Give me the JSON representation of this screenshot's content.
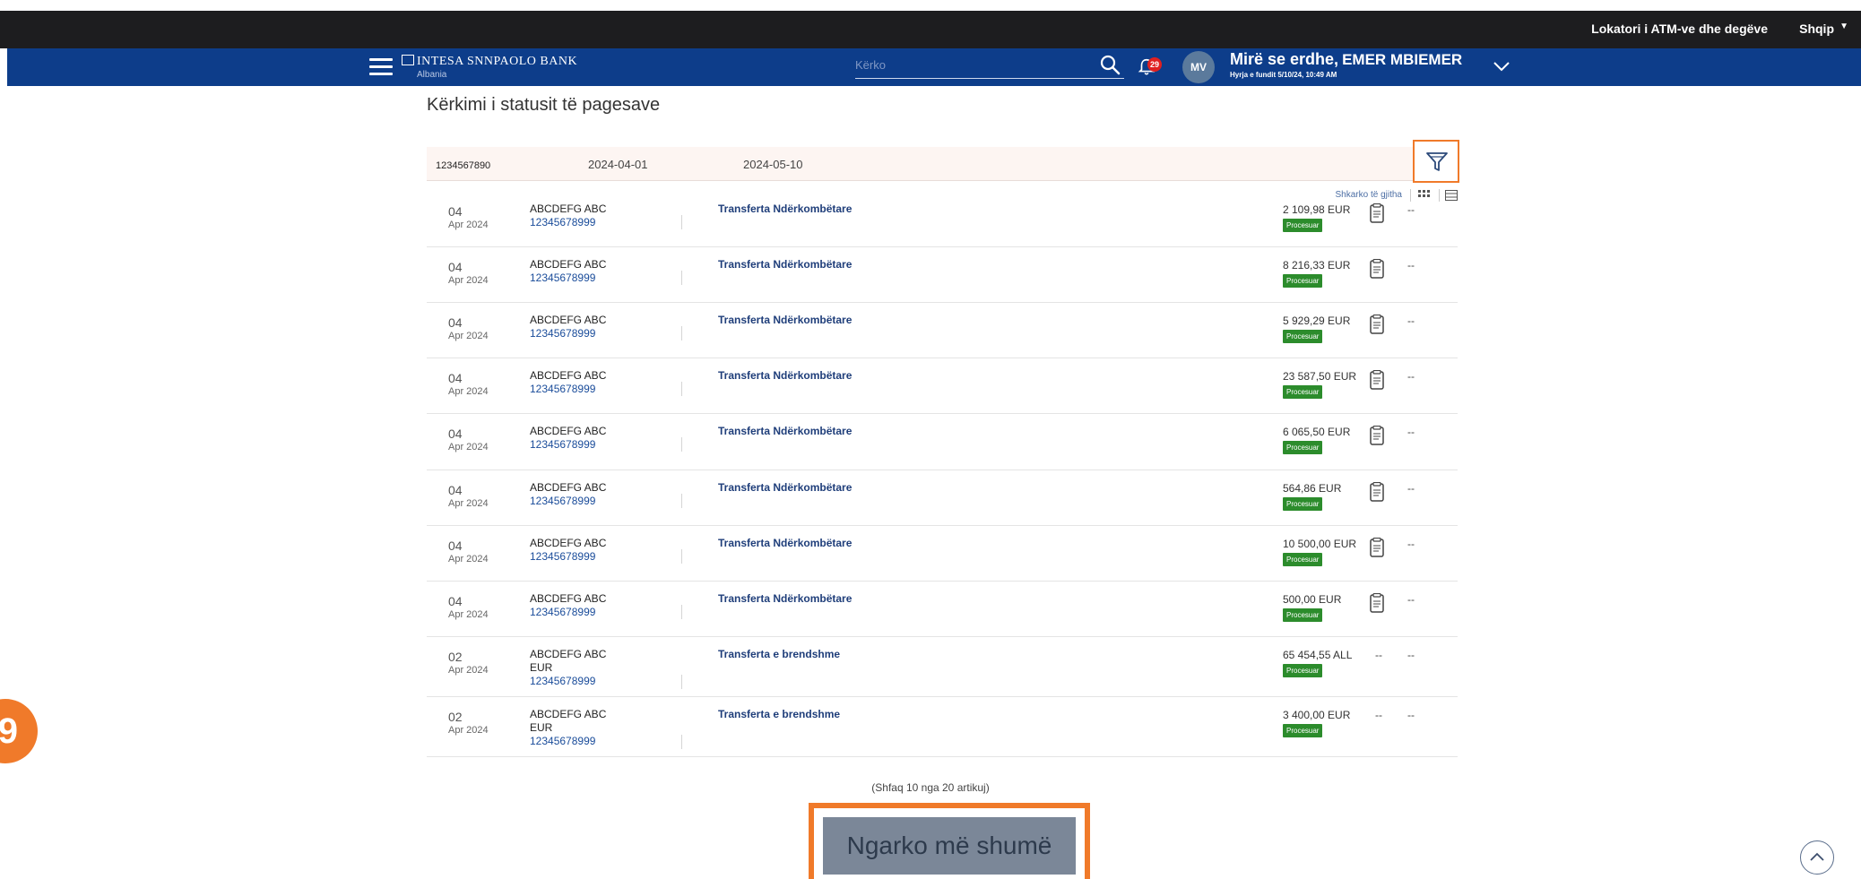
{
  "topbar": {
    "atm_link": "Lokatori i ATM-ve dhe degëve",
    "language": "Shqip"
  },
  "navbar": {
    "brand": "INTESA SNNPAOLO BANK",
    "brand_sub": "Albania",
    "search_placeholder": "Kërko",
    "notification_count": "29",
    "avatar_initials": "MV",
    "welcome": "Mirë se erdhe,",
    "user_name": "EMER MBIEMER",
    "last_login": "Hyrja e fundit 5/10/24, 10:49 AM"
  },
  "page": {
    "title": "Kërkimi i statusit të pagesave"
  },
  "filter": {
    "account": "1234567890",
    "date_from": "2024-04-01",
    "date_to": "2024-05-10"
  },
  "toolbar": {
    "download_all": "Shkarko të gjitha"
  },
  "transactions": [
    {
      "day": "04",
      "month": "Apr 2024",
      "name": "ABCDEFG ABC",
      "currency": "",
      "account": "12345678999",
      "type": "Transferta Ndërkombëtare",
      "amount": "2 109,98 EUR",
      "status": "Procesuar",
      "has_doc": true,
      "col1": "",
      "col2": "--"
    },
    {
      "day": "04",
      "month": "Apr 2024",
      "name": "ABCDEFG ABC",
      "currency": "",
      "account": "12345678999",
      "type": "Transferta Ndërkombëtare",
      "amount": "8 216,33 EUR",
      "status": "Procesuar",
      "has_doc": true,
      "col1": "",
      "col2": "--"
    },
    {
      "day": "04",
      "month": "Apr 2024",
      "name": "ABCDEFG ABC",
      "currency": "",
      "account": "12345678999",
      "type": "Transferta Ndërkombëtare",
      "amount": "5 929,29 EUR",
      "status": "Procesuar",
      "has_doc": true,
      "col1": "",
      "col2": "--"
    },
    {
      "day": "04",
      "month": "Apr 2024",
      "name": "ABCDEFG ABC",
      "currency": "",
      "account": "12345678999",
      "type": "Transferta Ndërkombëtare",
      "amount": "23 587,50 EUR",
      "status": "Procesuar",
      "has_doc": true,
      "col1": "",
      "col2": "--"
    },
    {
      "day": "04",
      "month": "Apr 2024",
      "name": "ABCDEFG ABC",
      "currency": "",
      "account": "12345678999",
      "type": "Transferta Ndërkombëtare",
      "amount": "6 065,50 EUR",
      "status": "Procesuar",
      "has_doc": true,
      "col1": "",
      "col2": "--"
    },
    {
      "day": "04",
      "month": "Apr 2024",
      "name": "ABCDEFG ABC",
      "currency": "",
      "account": "12345678999",
      "type": "Transferta Ndërkombëtare",
      "amount": "564,86 EUR",
      "status": "Procesuar",
      "has_doc": true,
      "col1": "",
      "col2": "--"
    },
    {
      "day": "04",
      "month": "Apr 2024",
      "name": "ABCDEFG ABC",
      "currency": "",
      "account": "12345678999",
      "type": "Transferta Ndërkombëtare",
      "amount": "10 500,00 EUR",
      "status": "Procesuar",
      "has_doc": true,
      "col1": "",
      "col2": "--"
    },
    {
      "day": "04",
      "month": "Apr 2024",
      "name": "ABCDEFG ABC",
      "currency": "",
      "account": "12345678999",
      "type": "Transferta Ndërkombëtare",
      "amount": "500,00 EUR",
      "status": "Procesuar",
      "has_doc": true,
      "col1": "",
      "col2": "--"
    },
    {
      "day": "02",
      "month": "Apr 2024",
      "name": "ABCDEFG ABC",
      "currency": "EUR",
      "account": "12345678999",
      "type": "Transferta e brendshme",
      "amount": "65 454,55 ALL",
      "status": "Procesuar",
      "has_doc": false,
      "col1": "--",
      "col2": "--"
    },
    {
      "day": "02",
      "month": "Apr 2024",
      "name": "ABCDEFG ABC",
      "currency": "EUR",
      "account": "12345678999",
      "type": "Transferta e brendshme",
      "amount": "3 400,00 EUR",
      "status": "Procesuar",
      "has_doc": false,
      "col1": "--",
      "col2": "--"
    }
  ],
  "footer": {
    "showing": "(Shfaq 10 nga 20 artikuj)",
    "load_more": "Ngarko më shumë"
  },
  "annotation": {
    "step": "9"
  },
  "colors": {
    "topbar": "#1d1d1f",
    "navbar": "#0d3d8a",
    "highlight": "#f07a2a",
    "status_green": "#2c8c2c"
  }
}
